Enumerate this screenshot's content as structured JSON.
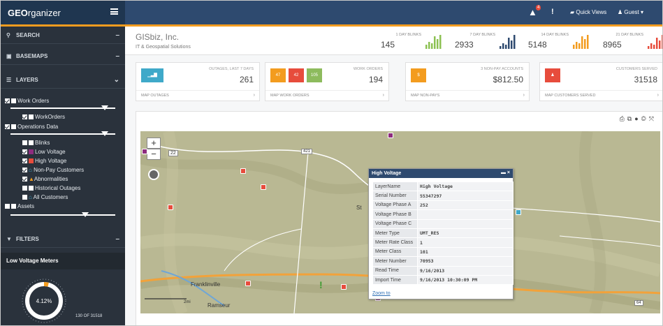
{
  "app": {
    "title_bold": "GEO",
    "title_rest": "rganizer",
    "alert_count": "4",
    "quick_views": "Quick Views",
    "guest": "Guest"
  },
  "sidebar": {
    "search": "Search",
    "basemaps": "Basemaps",
    "layers": "Layers",
    "tree": [
      {
        "label": "Work Orders",
        "checked": true
      },
      {
        "label": "WorkOrders",
        "checked": true
      },
      {
        "label": "Operations Data",
        "checked": true
      },
      {
        "label": "Blinks",
        "checked": false
      },
      {
        "label": "Low Voltage",
        "checked": true
      },
      {
        "label": "High Voltage",
        "checked": true
      },
      {
        "label": "Non-Pay Customers",
        "checked": true
      },
      {
        "label": "Abnormalities",
        "checked": true
      },
      {
        "label": "Historical Outages",
        "checked": false
      },
      {
        "label": "All Customers",
        "checked": false
      },
      {
        "label": "Assets",
        "checked": false
      }
    ],
    "filters": "Filters",
    "filter_caption": "Low Voltage Meters",
    "gauge_percent": "4.12%",
    "gauge_fraction": 0.0412,
    "gauge_count": "130 OF 31518"
  },
  "header": {
    "company": "GISbiz, Inc.",
    "tagline": "IT & Geospatial Solutions",
    "blinks": [
      {
        "label": "1 Day Blinks",
        "value": "145"
      },
      {
        "label": "7 Day Blinks",
        "value": "2933"
      },
      {
        "label": "14 Day Blinks",
        "value": "5148"
      },
      {
        "label": "21 Day Blinks",
        "value": "8965"
      }
    ]
  },
  "stats": {
    "outages": {
      "label": "Outages, Last 7 Days",
      "value": "261",
      "link": "Map Outages"
    },
    "workorders": {
      "label": "Work Orders",
      "value": "194",
      "link": "Map Work Orders",
      "tiles": [
        "47",
        "42",
        "105"
      ]
    },
    "nonpay": {
      "label": "3 Non-Pay Accounts",
      "value": "$812.50",
      "link": "Map Non-Pays",
      "tile": "$"
    },
    "customers": {
      "label": "Customers Served",
      "value": "31518",
      "link": "Map Customers Served"
    }
  },
  "map": {
    "labels": {
      "franklinville": "Franklinville",
      "ramseur": "Ramseur",
      "route22": "22",
      "route421": "421",
      "route64": "64",
      "scale": "2mi",
      "st": "St"
    },
    "popup": {
      "title": "High Voltage",
      "rows": [
        {
          "k": "LayerName",
          "v": "High Voltage"
        },
        {
          "k": "Serial Number",
          "v": "55347297"
        },
        {
          "k": "Voltage Phase A",
          "v": "252"
        },
        {
          "k": "Voltage Phase B",
          "v": ""
        },
        {
          "k": "Voltage Phase C",
          "v": ""
        },
        {
          "k": "Meter Type",
          "v": "UMT_RES"
        },
        {
          "k": "Meter Rate Class",
          "v": "1"
        },
        {
          "k": "Meter Class",
          "v": "101"
        },
        {
          "k": "Meter Number",
          "v": "70953"
        },
        {
          "k": "Read Time",
          "v": "9/16/2013"
        },
        {
          "k": "Import Time",
          "v": "9/16/2013 10:30:09 PM"
        }
      ],
      "zoom_to": "Zoom to"
    }
  },
  "colors": {
    "navy": "#2e4a6f",
    "orange": "#f39c1f",
    "green": "#8cc152",
    "red": "#e74c3c",
    "teal": "#3fa9c9",
    "olive": "#8dbb5d"
  }
}
